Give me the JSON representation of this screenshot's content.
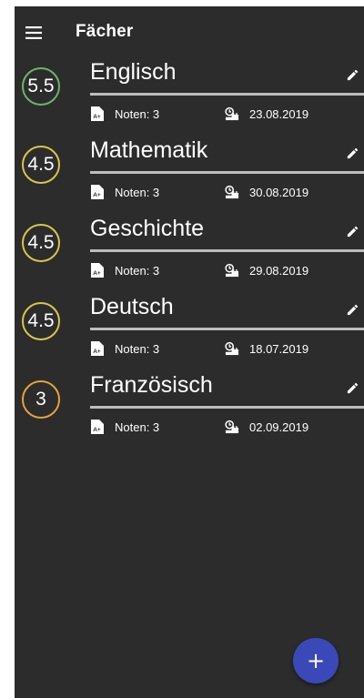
{
  "appbar": {
    "title": "Fächer",
    "menu_icon": "menu-icon"
  },
  "colors": {
    "background": "#2c2c2c",
    "fab": "#3a49b7",
    "grade_high": "#6db36a",
    "grade_mid": "#d7c64a",
    "grade_low": "#e6a23c",
    "divider": "#bdbdbd"
  },
  "subjects": [
    {
      "name": "Englisch",
      "grade": "5.5",
      "grade_color": "#6db36a",
      "notes": "Noten: 3",
      "date": "23.08.2019"
    },
    {
      "name": "Mathematik",
      "grade": "4.5",
      "grade_color": "#d7c64a",
      "notes": "Noten: 3",
      "date": "30.08.2019"
    },
    {
      "name": "Geschichte",
      "grade": "4.5",
      "grade_color": "#d7c64a",
      "notes": "Noten: 3",
      "date": "29.08.2019"
    },
    {
      "name": "Deutsch",
      "grade": "4.5",
      "grade_color": "#d7c64a",
      "notes": "Noten: 3",
      "date": "18.07.2019"
    },
    {
      "name": "Französisch",
      "grade": "3",
      "grade_color": "#e6a23c",
      "notes": "Noten: 3",
      "date": "02.09.2019"
    }
  ],
  "fab": {
    "label": "+",
    "icon": "add-icon"
  }
}
